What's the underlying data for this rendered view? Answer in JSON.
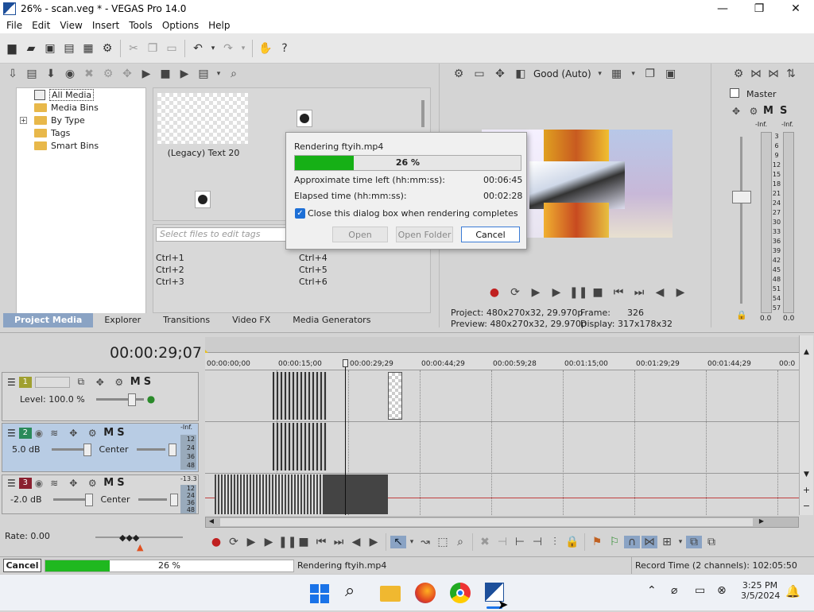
{
  "window": {
    "title": "26% - scan.veg * - VEGAS Pro 14.0"
  },
  "menu": [
    "File",
    "Edit",
    "View",
    "Insert",
    "Tools",
    "Options",
    "Help"
  ],
  "tree": {
    "items": [
      {
        "label": "All Media"
      },
      {
        "label": "Media Bins"
      },
      {
        "label": "By Type"
      },
      {
        "label": "Tags"
      },
      {
        "label": "Smart Bins"
      }
    ]
  },
  "media": {
    "item_label": "(Legacy) Text 20"
  },
  "tags": {
    "placeholder": "Select files to edit tags",
    "shortcuts": [
      "Ctrl+1",
      "Ctrl+2",
      "Ctrl+3",
      "Ctrl+4",
      "Ctrl+5",
      "Ctrl+6"
    ]
  },
  "tabs": [
    "Project Media",
    "Explorer",
    "Transitions",
    "Video FX",
    "Media Generators"
  ],
  "preview": {
    "quality": "Good (Auto)",
    "project_label": "Project:",
    "project_value": "480x270x32, 29.970p",
    "preview_label": "Preview:",
    "preview_value": "480x270x32, 29.970p",
    "frame_label": "Frame:",
    "frame_value": "326",
    "display_label": "Display:",
    "display_value": "317x178x32"
  },
  "master": {
    "title": "Master",
    "inf_l": "-Inf.",
    "inf_r": "-Inf.",
    "scale": [
      "3",
      "6",
      "9",
      "12",
      "15",
      "18",
      "21",
      "24",
      "27",
      "30",
      "33",
      "36",
      "39",
      "42",
      "45",
      "48",
      "51",
      "54",
      "57"
    ],
    "bottom_l": "0.0",
    "bottom_r": "0.0"
  },
  "timeline": {
    "timecode": "00:00:29;07",
    "ruler": [
      "00:00:00;00",
      "00:00:15;00",
      "00:00:29;29",
      "00:00:44;29",
      "00:00:59;28",
      "00:01:15;00",
      "00:01:29;29",
      "00:01:44;29",
      "00:0"
    ],
    "tracks": [
      {
        "num": "1",
        "label": "Level: 100.0 %",
        "color": "#a0a030"
      },
      {
        "num": "2",
        "label": "5.0 dB",
        "pan": "Center",
        "meter_top": "-Inf.",
        "color": "#2a8a5a"
      },
      {
        "num": "3",
        "label": "-2.0 dB",
        "pan": "Center",
        "meter_top": "-13.3",
        "color": "#8a2030"
      }
    ],
    "meter_scale": [
      "12",
      "24",
      "36",
      "48"
    ],
    "rate": "Rate: 0.00"
  },
  "dialog": {
    "title": "Rendering ftyih.mp4",
    "progress_text": "26 %",
    "progress": 0.26,
    "time_left_label": "Approximate time left (hh:mm:ss):",
    "time_left": "00:06:45",
    "elapsed_label": "Elapsed time (hh:mm:ss):",
    "elapsed": "00:02:28",
    "checkbox_label": "Close this dialog box when rendering completes",
    "open": "Open",
    "open_folder": "Open Folder",
    "cancel": "Cancel"
  },
  "status": {
    "cancel": "Cancel",
    "progress_text": "26 %",
    "progress": 0.26,
    "message": "Rendering ftyih.mp4",
    "record_time": "Record Time (2 channels): 102:05:50"
  },
  "taskbar": {
    "time": "3:25 PM",
    "date": "3/5/2024"
  }
}
